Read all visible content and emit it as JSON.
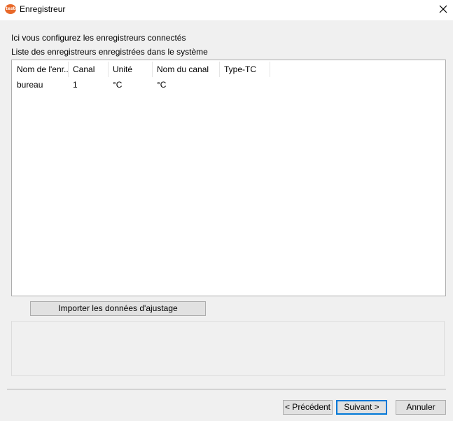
{
  "window": {
    "title": "Enregistreur",
    "app_icon": "testo-logo-icon",
    "logo_text": "testo",
    "close_icon": "close-icon"
  },
  "intro": {
    "line1": "Ici vous configurez les enregistreurs connectés",
    "line2": "Liste des enregistreurs enregistrées dans le système"
  },
  "list": {
    "columns": [
      "Nom de l'enr...",
      "Canal",
      "Unité",
      "Nom du canal",
      "Type-TC"
    ],
    "rows": [
      [
        "bureau",
        "1",
        "°C",
        "°C",
        ""
      ]
    ]
  },
  "buttons": {
    "import": "Importer les données d'ajustage",
    "previous": "< Précédent",
    "next": "Suivant >",
    "cancel": "Annuler"
  },
  "colors": {
    "brand": "#e8692a",
    "focus": "#0078d7"
  }
}
